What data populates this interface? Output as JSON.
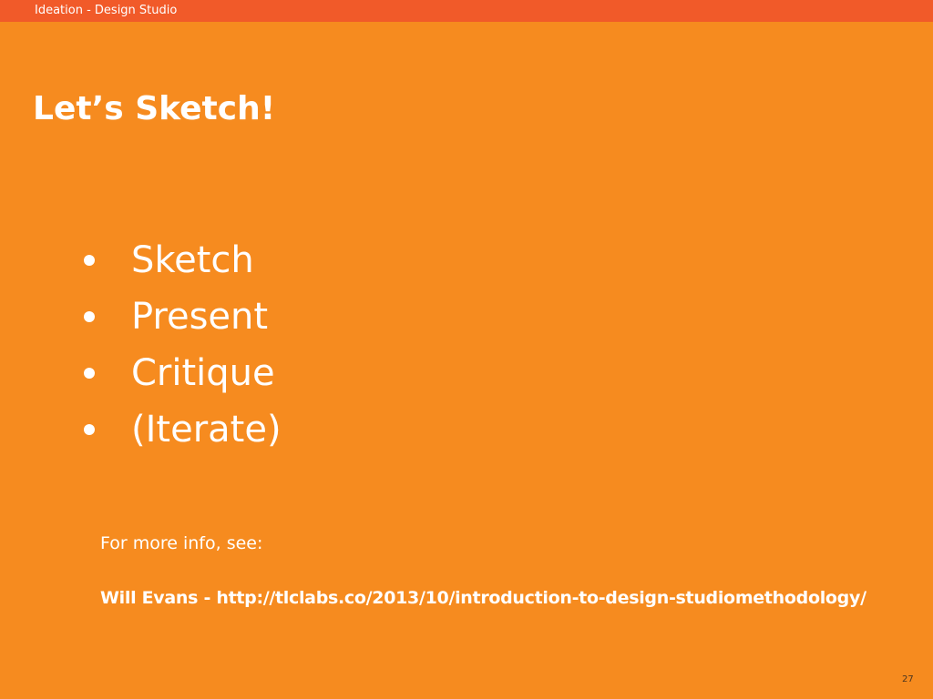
{
  "header": {
    "title": "Ideation - Design Studio"
  },
  "slide": {
    "title": "Let’s Sketch!",
    "bullets": [
      "Sketch",
      "Present",
      "Critique",
      "(Iterate)"
    ],
    "info_label": "For more info, see:",
    "info_reference": "Will Evans - http://tlclabs.co/2013/10/introduction-to-design-studiomethodology/",
    "page_number": "27"
  },
  "colors": {
    "background": "#f68b1f",
    "header_bar": "#f15a29",
    "text": "#ffffff",
    "page_number": "#4a3520"
  }
}
